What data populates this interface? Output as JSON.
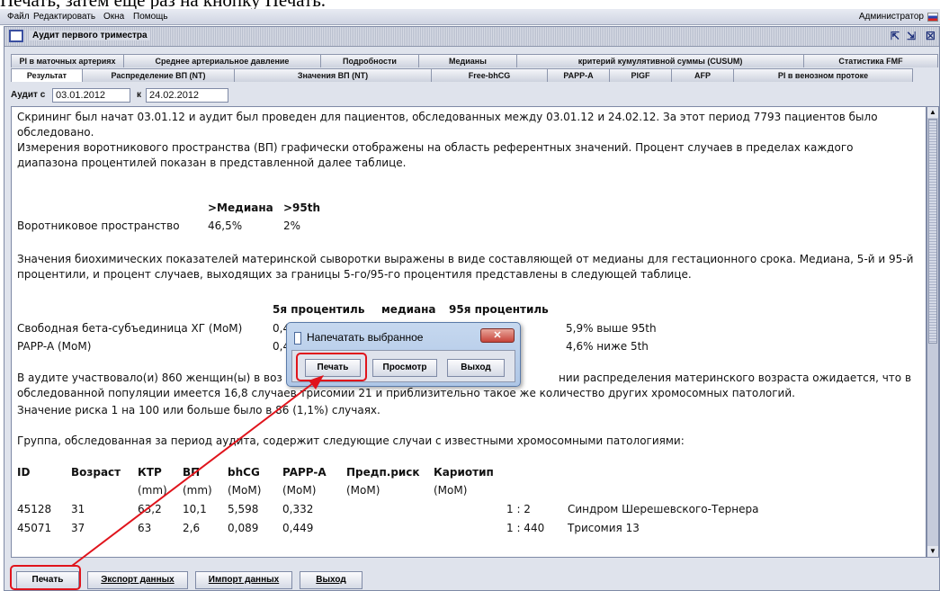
{
  "caption": "Печать, затем еще раз на кнопку Печать.",
  "menu": {
    "items": [
      "Файл",
      "Редактировать",
      "Окна",
      "Помощь"
    ],
    "user": "Администратор"
  },
  "window": {
    "title": "Аудит первого триместра"
  },
  "tabs": {
    "row1": [
      "PI в маточных артериях",
      "Среднее артериальное давление",
      "Подробности",
      "Медианы",
      "критерий кумулятивной суммы (CUSUM)",
      "Статистика FMF"
    ],
    "row2": [
      "Результат",
      "Распределение ВП (NT)",
      "Значения ВП (NT)",
      "Free-bhCG",
      "PAPP-A",
      "PlGF",
      "AFP",
      "PI в венозном протоке"
    ],
    "active": "Результат"
  },
  "audit": {
    "from_label": "Аудит с",
    "from_value": "03.01.2012",
    "to_label": "к",
    "to_value": "24.02.2012"
  },
  "report": {
    "p1": "Скрининг был начат 03.01.12 и аудит был проведен для пациентов, обследованных между 03.01.12 и 24.02.12. За этот период 7793 пациентов было обследовано.",
    "p2": "Измерения воротникового пространства (ВП) графически отображены на область референтных значений. Процент случаев в пределах каждого диапазона процентилей показан в представленной далее таблице.",
    "nt_table": {
      "col1": ">Медиана",
      "col2": ">95th",
      "row_label": "Воротниковое пространство",
      "v1": "46,5%",
      "v2": "2%"
    },
    "p3": "Значения биохимических показателей материнской сыворотки выражены в виде составляющей от медианы для гестационного срока. Медиана, 5-й и 95-й процентили, и процент случаев, выходящих за границы 5-го/95-го процентиля представлены в следующей таблице.",
    "bio_table": {
      "headers": [
        "5я процентиль",
        "медиана",
        "95я процентиль"
      ],
      "rows": [
        {
          "label": "Свободная бета-субъединица ХГ (MoM)",
          "p5": "0,4",
          "note": "5,9% выше 95th"
        },
        {
          "label": "PAPP-A (MoM)",
          "p5": "0,4",
          "note": "4,6% ниже 5th"
        }
      ]
    },
    "p4_left": "В аудите участвовало(и) 860 женщин(ы) в воз",
    "p4_right": "нии распределения материнского возраста ожидается, что в",
    "p4_line2": "обследованной популяции имеется 16,8 случаев трисомии 21 и приблизительно такое же количество других хромосомных патологий.",
    "p5": "Значение риска 1 на 100 или больше было в 86 (1,1%) случаях.",
    "p6": "Группа, обследованная за период аудита, содержит следующие случаи с известными хромосомными патологиями:",
    "cases_table": {
      "headers": [
        "ID",
        "Возраст",
        "КТР",
        "ВП",
        "bhCG",
        "PAPP-A",
        "Предп.риск",
        "Кариотип"
      ],
      "units": [
        "",
        "",
        "(mm)",
        "(mm)",
        "(MoM)",
        "(MoM)",
        "(MoM)",
        "(MoM)"
      ],
      "rows": [
        [
          "45128",
          "31",
          "63,2",
          "10,1",
          "5,598",
          "0,332",
          "",
          "",
          "1 : 2",
          "Синдром Шерешевского-Тернера"
        ],
        [
          "45071",
          "37",
          "63",
          "2,6",
          "0,089",
          "0,449",
          "",
          "",
          "1 : 440",
          "Трисомия 13"
        ]
      ]
    }
  },
  "bottom_buttons": {
    "print": "Печать",
    "export": "Экспорт данных",
    "import": "Импорт данных",
    "exit": "Выход"
  },
  "dialog": {
    "title": "Напечатать выбранное",
    "print": "Печать",
    "preview": "Просмотр",
    "exit": "Выход"
  },
  "colors": {
    "highlight": "#e0141c",
    "window_bg": "#dfe3ec",
    "dialog_bg": "#aec6e6"
  }
}
